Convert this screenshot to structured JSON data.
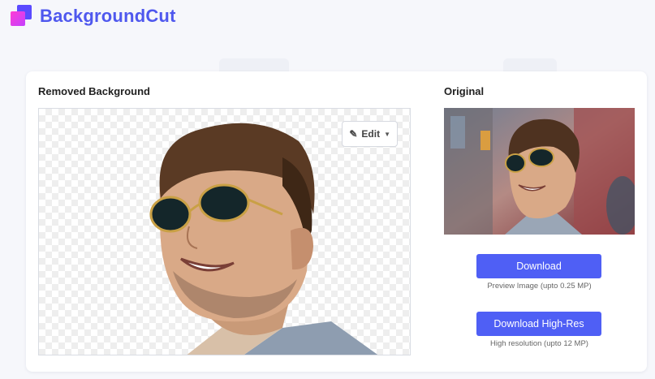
{
  "brand": {
    "name": "BackgroundCut"
  },
  "result": {
    "title": "Removed Background",
    "edit_label": "Edit"
  },
  "original": {
    "title": "Original"
  },
  "actions": {
    "download_label": "Download",
    "download_hint": "Preview Image (upto 0.25 MP)",
    "download_hires_label": "Download High-Res",
    "download_hires_hint": "High resolution (upto 12 MP)"
  },
  "colors": {
    "brand_text": "#4f58ee",
    "button_bg": "#4f5ff5",
    "page_bg": "#f6f7fb"
  }
}
